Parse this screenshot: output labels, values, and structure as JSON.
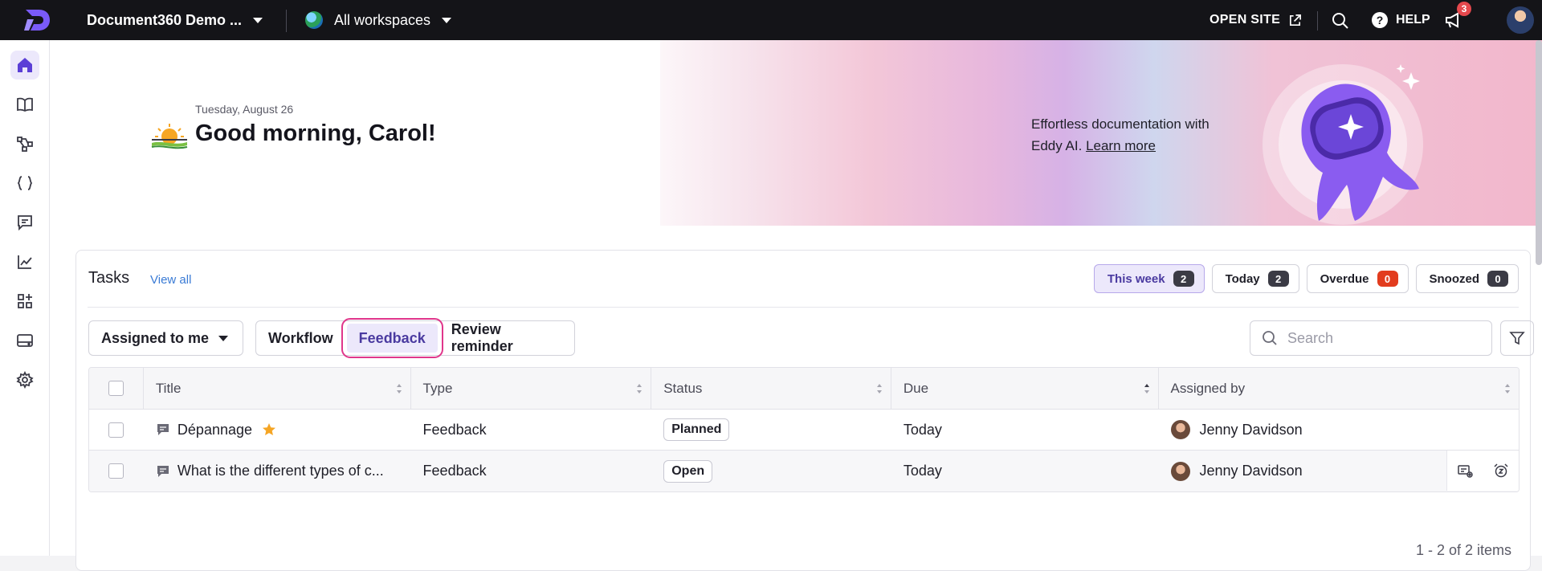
{
  "topbar": {
    "project_name": "Document360 Demo ...",
    "workspace": "All workspaces",
    "open_site": "OPEN SITE",
    "help": "HELP",
    "notifications": "3"
  },
  "sidebar": {
    "items": [
      {
        "icon": "home-icon",
        "active": true
      },
      {
        "icon": "book-icon"
      },
      {
        "icon": "workflow-icon"
      },
      {
        "icon": "code-braces-icon"
      },
      {
        "icon": "feedback-icon"
      },
      {
        "icon": "analytics-icon"
      },
      {
        "icon": "apps-icon"
      },
      {
        "icon": "drive-icon"
      },
      {
        "icon": "settings-icon"
      }
    ]
  },
  "banner": {
    "date": "Tuesday, August 26",
    "greeting": "Good morning, Carol!",
    "promo_text": "Effortless documentation with Eddy AI.",
    "promo_link": "Learn more"
  },
  "tasks": {
    "title": "Tasks",
    "view_all": "View all",
    "filters": [
      {
        "label": "This week",
        "count": "2"
      },
      {
        "label": "Today",
        "count": "2"
      },
      {
        "label": "Overdue",
        "count": "0"
      },
      {
        "label": "Snoozed",
        "count": "0"
      }
    ],
    "assigned_select": "Assigned to me",
    "tabs": [
      "Workflow",
      "Feedback",
      "Review reminder"
    ],
    "search_placeholder": "Search",
    "columns": [
      "Title",
      "Type",
      "Status",
      "Due",
      "Assigned by"
    ],
    "rows": [
      {
        "title": "Dépannage",
        "type": "Feedback",
        "status": "Planned",
        "due": "Today",
        "assigned_by": "Jenny Davidson"
      },
      {
        "title": "What is the different types of c...",
        "type": "Feedback",
        "status": "Open",
        "due": "Today",
        "assigned_by": "Jenny Davidson"
      }
    ],
    "pager": "1 - 2 of 2 items"
  },
  "colors": {
    "accent": "#4a3aa0",
    "accent_bg": "#ece8fb",
    "highlight_outline": "#e0368b",
    "badge_red": "#e23c1e",
    "topbar_bg": "#141418"
  }
}
